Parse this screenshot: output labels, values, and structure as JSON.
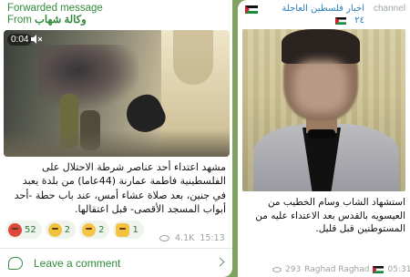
{
  "left_post": {
    "forwarded_label": "Forwarded message",
    "from_prefix": "From",
    "source_name": "وكالة شهاب",
    "video": {
      "duration": "0:04",
      "muted_icon": "speaker-muted-icon"
    },
    "text": "مشهد اعتداء أحد عناصر شرطة الاحتلال على الفلسطينية فاطمة عمارنة (44عاما) من بلدة يعبد في جنين، بعد صلاة عشاء أمس، عند باب حطة -أحد أبواب المسجد الأقصى- قبل اعتقالها.",
    "reactions": [
      {
        "icon": "angry-face-icon",
        "count": "52"
      },
      {
        "icon": "thinking-face-icon",
        "count": "2"
      },
      {
        "icon": "laughing-face-icon",
        "count": "2"
      },
      {
        "icon": "thumbs-up-icon",
        "count": "1"
      }
    ],
    "views": "4.1K",
    "time": "15:13",
    "comment_label": "Leave a comment"
  },
  "right_post": {
    "channel_name": "اخبار فلسطين العاجلة",
    "channel_badge": "٢٤",
    "channel_label": "channel",
    "text": "استشهاد الشاب  وسام الخطيب من العيسويه بالقدس بعد الاعتداء عليه من المستوطنين قبل قليل.",
    "views": "293",
    "author": "Raghad Raghad",
    "time": "05:31"
  },
  "colors": {
    "accent_green": "#2f8a3a",
    "channel_blue": "#2c7fb8",
    "background": "#7fa35e"
  }
}
